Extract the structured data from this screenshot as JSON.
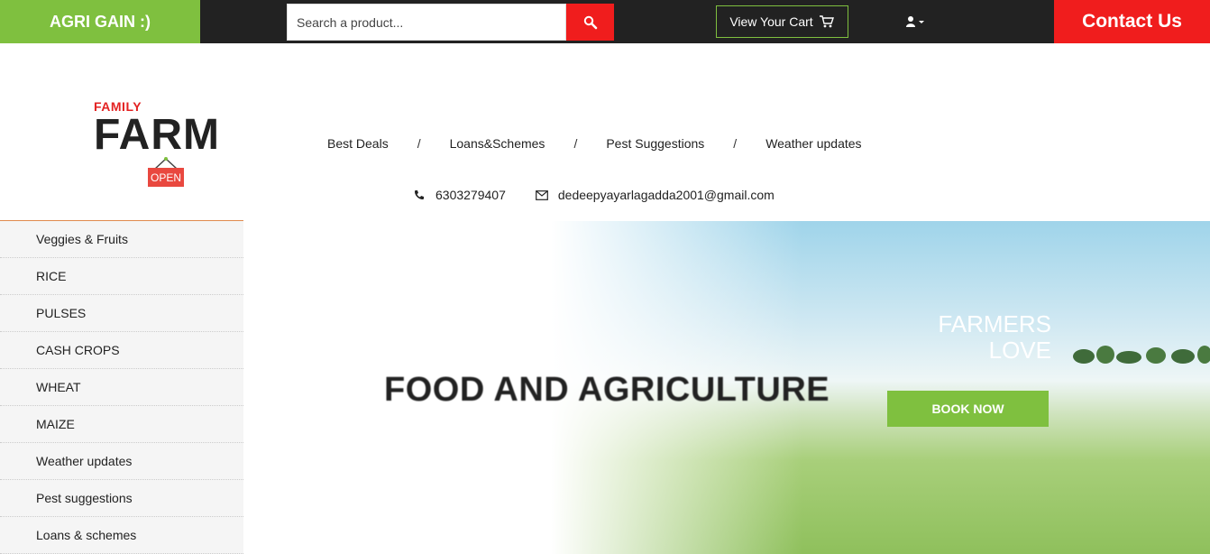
{
  "topbar": {
    "brand": "AGRI GAIN :)",
    "search_placeholder": "Search a product...",
    "search_icon": "search-icon",
    "cart_label": "View Your Cart",
    "cart_icon": "cart-icon",
    "user_icon": "user-icon",
    "contact_label": "Contact Us"
  },
  "logo": {
    "family": "FAMILY",
    "farm": "FARM",
    "open": "OPEN"
  },
  "nav": {
    "items": [
      "Best Deals",
      "Loans&Schemes",
      "Pest Suggestions",
      "Weather updates"
    ],
    "separator": "/"
  },
  "contact": {
    "phone": "6303279407",
    "email": "dedeepyayarlagadda2001@gmail.com"
  },
  "sidebar": {
    "items": [
      "Veggies & Fruits",
      "RICE",
      "PULSES",
      "CASH CROPS",
      "WHEAT",
      "MAIZE",
      "Weather updates",
      "Pest suggestions",
      "Loans & schemes"
    ]
  },
  "hero": {
    "title": "FOOD AND AGRICULTURE",
    "subtitle": "FARMERS LOVE",
    "button": "BOOK NOW"
  },
  "colors": {
    "green": "#7fc03f",
    "red": "#f01d1d",
    "dark": "#222222"
  }
}
